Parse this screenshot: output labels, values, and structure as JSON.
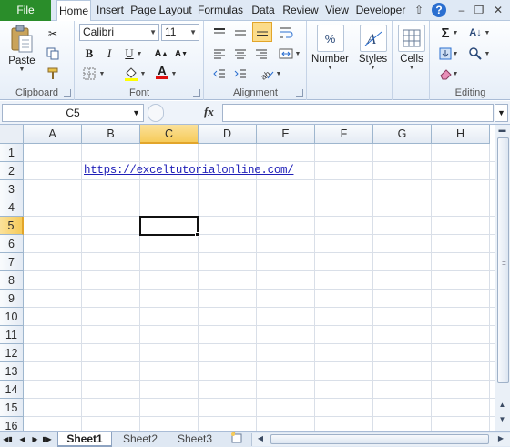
{
  "tabs": {
    "file": "File",
    "items": [
      "Home",
      "Insert",
      "Page Layout",
      "Formulas",
      "Data",
      "Review",
      "View",
      "Developer"
    ],
    "active": "Home"
  },
  "window_controls": {
    "help": "?"
  },
  "ribbon": {
    "clipboard": {
      "label": "Clipboard",
      "paste_label": "Paste"
    },
    "font": {
      "label": "Font",
      "font_name": "Calibri",
      "font_size": "11"
    },
    "alignment": {
      "label": "Alignment"
    },
    "number": {
      "label": "Number",
      "icon_text": "%"
    },
    "styles": {
      "label": "Styles"
    },
    "cells": {
      "label": "Cells"
    },
    "editing": {
      "label": "Editing"
    }
  },
  "formula_bar": {
    "name_box": "C5",
    "fx": "fx",
    "formula": ""
  },
  "grid": {
    "columns": [
      "A",
      "B",
      "C",
      "D",
      "E",
      "F",
      "G",
      "H"
    ],
    "rows": [
      "1",
      "2",
      "3",
      "4",
      "5",
      "6",
      "7",
      "8",
      "9",
      "10",
      "11",
      "12",
      "13",
      "14",
      "15",
      "16"
    ],
    "selected_column": "C",
    "selected_row": "5",
    "cells": {
      "B2": "https://exceltutorialonline.com/"
    }
  },
  "sheets": {
    "items": [
      "Sheet1",
      "Sheet2",
      "Sheet3"
    ],
    "active": "Sheet1"
  },
  "colors": {
    "file_tab": "#2a8d2a",
    "selection": "#f6cb5a",
    "hyperlink": "#1f1fb8"
  }
}
